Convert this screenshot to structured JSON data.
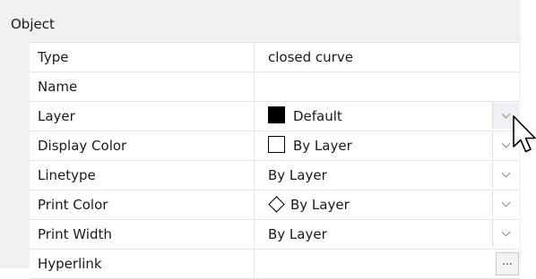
{
  "section": {
    "title": "Object"
  },
  "properties": [
    {
      "label": "Type",
      "value": "closed curve",
      "control": "none"
    },
    {
      "label": "Name",
      "value": "",
      "control": "none"
    },
    {
      "label": "Layer",
      "value": "Default",
      "control": "dropdown",
      "icon": "black-swatch-icon"
    },
    {
      "label": "Display Color",
      "value": "By Layer",
      "control": "dropdown",
      "icon": "empty-swatch-icon"
    },
    {
      "label": "Linetype",
      "value": "By Layer",
      "control": "dropdown",
      "icon": ""
    },
    {
      "label": "Print Color",
      "value": "By Layer",
      "control": "dropdown",
      "icon": "diamond-icon"
    },
    {
      "label": "Print Width",
      "value": "By Layer",
      "control": "dropdown",
      "icon": ""
    },
    {
      "label": "Hyperlink",
      "value": "",
      "control": "ellipsis",
      "button_label": "..."
    }
  ],
  "colors": {
    "panel_bg": "#f0f0f0",
    "grid_bg": "#ffffff",
    "grid_line": "#e4e4e4",
    "swatch_fill": "#000000"
  },
  "cursor": {
    "icon": "arrow-cursor-icon"
  }
}
